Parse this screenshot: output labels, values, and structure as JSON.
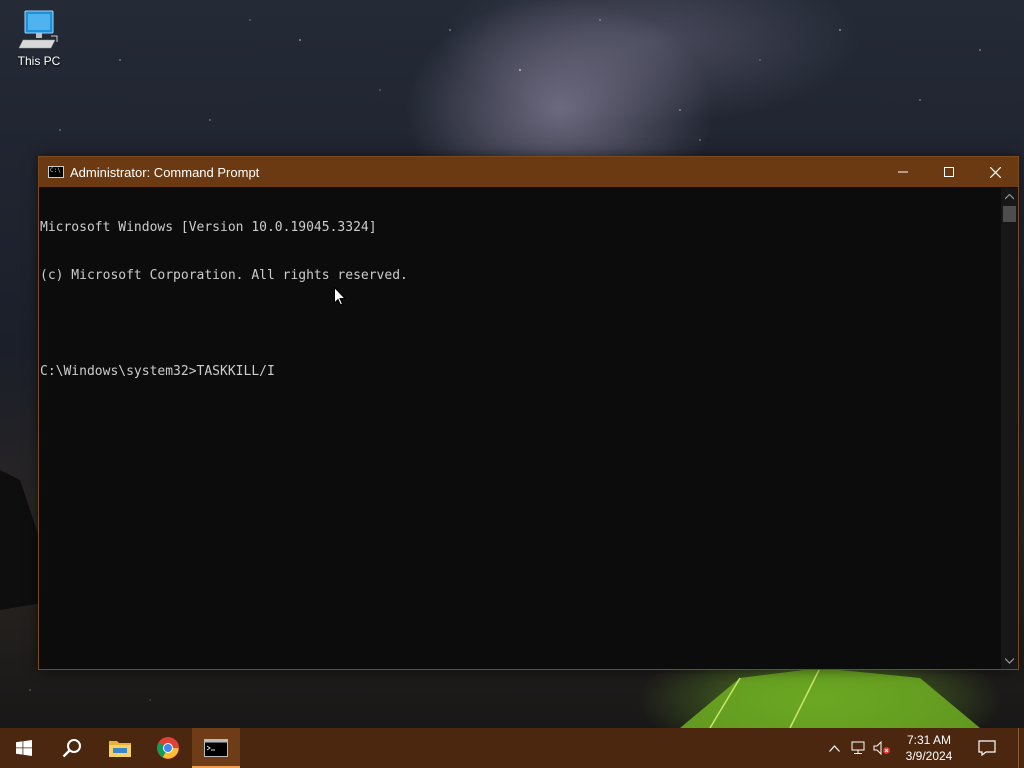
{
  "desktop": {
    "icons": [
      {
        "label": "This PC",
        "icon": "computer-icon"
      }
    ]
  },
  "window": {
    "title": "Administrator: Command Prompt",
    "icon": "cmd-icon",
    "controls": {
      "minimize": "minimize-icon",
      "maximize": "maximize-icon",
      "close": "close-icon"
    },
    "console_lines": [
      "Microsoft Windows [Version 10.0.19045.3324]",
      "(c) Microsoft Corporation. All rights reserved.",
      "",
      "C:\\Windows\\system32>TASKKILL/I"
    ]
  },
  "taskbar": {
    "items": [
      {
        "name": "start-button",
        "icon": "windows-logo-icon"
      },
      {
        "name": "search-button",
        "icon": "search-icon"
      },
      {
        "name": "file-explorer-button",
        "icon": "folder-icon"
      },
      {
        "name": "chrome-button",
        "icon": "chrome-icon"
      },
      {
        "name": "command-prompt-button",
        "icon": "cmd-icon",
        "active": true
      }
    ],
    "tray": {
      "icons": [
        "chevron-up-icon",
        "network-icon",
        "volume-muted-icon"
      ],
      "time": "7:31 AM",
      "date": "3/9/2024",
      "notification_icon": "notification-icon"
    }
  },
  "colors": {
    "accent": "#6b3a12",
    "taskbar": "#4c2710",
    "console_bg": "#0c0c0c",
    "console_text": "#cccccc"
  }
}
